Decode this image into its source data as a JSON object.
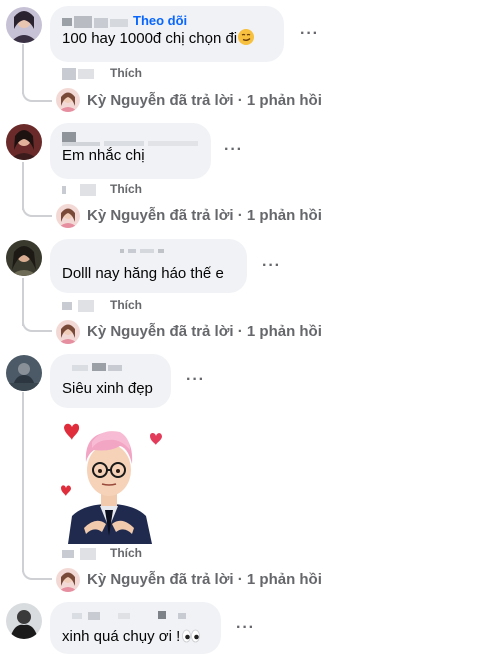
{
  "comments": [
    {
      "text": "100 hay 1000đ chị chọn đi",
      "follow_label": "Theo dõi",
      "like_label": "Thích",
      "reply_author": "Kỳ Nguyễn",
      "reply_action": "đã trả lời",
      "reply_separator": "·",
      "reply_count": "1 phản hồi"
    },
    {
      "text": "Em nhắc chị",
      "like_label": "Thích",
      "reply_author": "Kỳ Nguyễn",
      "reply_action": "đã trả lời",
      "reply_separator": "·",
      "reply_count": "1 phản hồi"
    },
    {
      "text": "Dolll nay hăng háo thế e",
      "like_label": "Thích",
      "reply_author": "Kỳ Nguyễn",
      "reply_action": "đã trả lời",
      "reply_separator": "·",
      "reply_count": "1 phản hồi"
    },
    {
      "text": "Siêu xinh đẹp",
      "like_label": "Thích",
      "sticker": "avatar-sticker-pink-hair-heart-hands",
      "reply_author": "Kỳ Nguyễn",
      "reply_action": "đã trả lời",
      "reply_separator": "·",
      "reply_count": "1 phản hồi"
    },
    {
      "text": "xinh quá chụy ơi !"
    }
  ],
  "more_options_label": "···",
  "icons": {
    "emoji_1": "smirk-face-emoji",
    "emoji_5": "eyes-emoji",
    "more": "more-options-icon"
  },
  "colors": {
    "link": "#0866ff",
    "bubble": "#f0f2f5",
    "secondary_text": "#65676b"
  }
}
